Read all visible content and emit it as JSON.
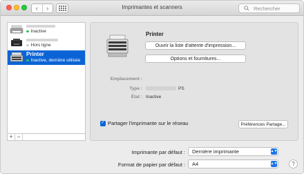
{
  "window": {
    "title": "Imprimantes et scanners"
  },
  "toolbar": {
    "back": "‹",
    "forward": "›",
    "search_placeholder": "Rechercher"
  },
  "printers": [
    {
      "status": "Inactive",
      "status_color": "#34c84a",
      "selected": false
    },
    {
      "status": "Hors ligne",
      "status_color": "#c9c9c9",
      "selected": false
    },
    {
      "name": "Printer",
      "status": "Inactive, dernière utilisée",
      "status_color": "#34c84a",
      "selected": true
    }
  ],
  "list_footer": {
    "add": "+",
    "remove": "−"
  },
  "detail": {
    "title": "Printer",
    "open_queue_label": "Ouvrir la liste d'attente d'impression...",
    "options_label": "Options et fournitures...",
    "location_label": "Emplacement :",
    "location_value": "",
    "type_label": "Type :",
    "type_value": "PS",
    "state_label": "État :",
    "state_value": "Inactive",
    "share_label": "Partager l'imprimante sur le réseau",
    "share_checked": true,
    "share_prefs_label": "Préférences Partage..."
  },
  "defaults": {
    "default_printer_label": "Imprimante par défaut :",
    "default_printer_value": "Dernière imprimante",
    "paper_label": "Format de papier par défaut :",
    "paper_value": "A4"
  },
  "help": "?"
}
